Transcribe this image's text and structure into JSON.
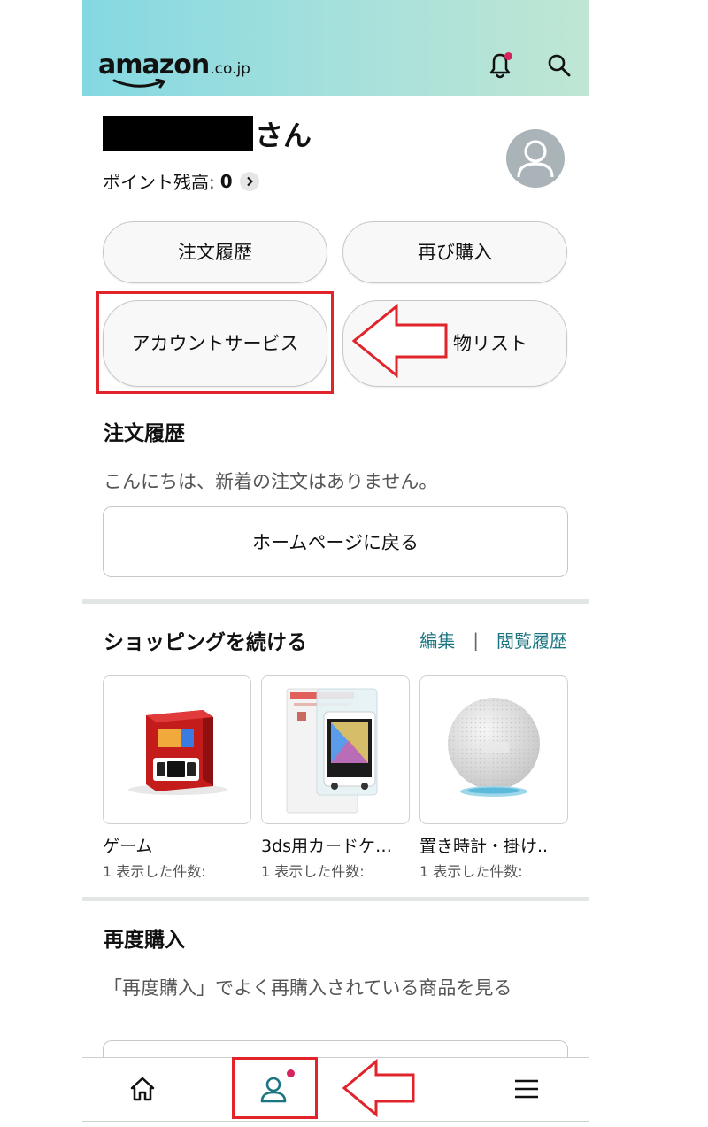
{
  "header": {
    "logo_word": "amazon",
    "logo_tld": ".co.jp",
    "icons": [
      "bell-icon",
      "search-icon"
    ]
  },
  "greeting": {
    "suffix": "さん"
  },
  "points": {
    "label": "ポイント残高:",
    "value": "0"
  },
  "quick_buttons": [
    "注文履歴",
    "再び購入",
    "アカウントサービス",
    "物リスト"
  ],
  "orders": {
    "title": "注文履歴",
    "message": "こんにちは、新着の注文はありません。",
    "home_button": "ホームページに戻る"
  },
  "continue_shopping": {
    "title": "ショッピングを続ける",
    "edit_link": "編集",
    "separator": "|",
    "history_link": "閲覧履歴",
    "items": [
      {
        "title": "ゲーム",
        "subtitle": "1 表示した件数:"
      },
      {
        "title": "3ds用カードケ…",
        "subtitle": "1 表示した件数:"
      },
      {
        "title": "置き時計・掛け..",
        "subtitle": "1 表示した件数:"
      }
    ]
  },
  "buy_again": {
    "title": "再度購入",
    "message": "「再度購入」でよく再購入されている商品を見る"
  },
  "bottom_nav": [
    "home-icon",
    "account-icon",
    "menu-icon"
  ],
  "colors": {
    "accent": "#1c7682",
    "notification": "#d6245e",
    "highlight": "#e0242a"
  }
}
